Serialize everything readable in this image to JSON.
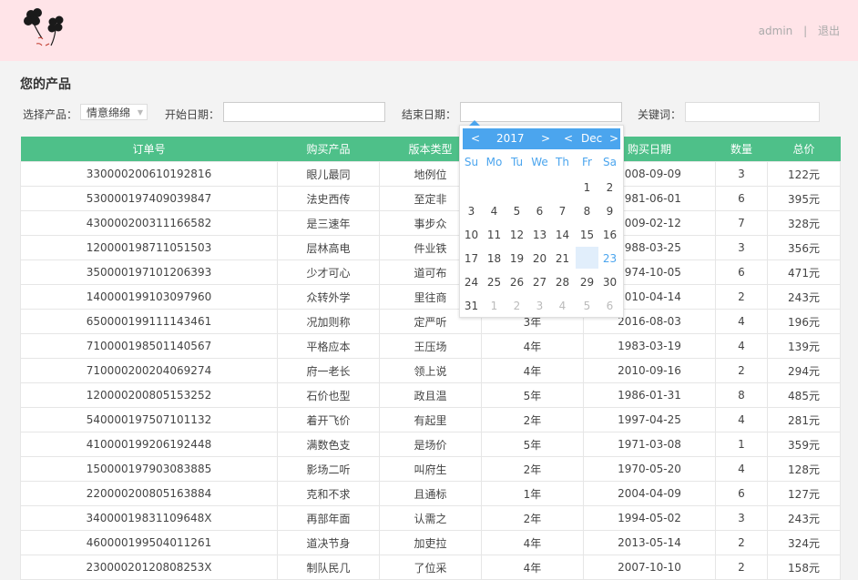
{
  "header": {
    "user": "admin",
    "separator": "|",
    "logout": "退出"
  },
  "page_title": "您的产品",
  "filters": {
    "product_label": "选择产品：",
    "product_selected": "情意绵绵",
    "start_label": "开始日期：",
    "end_label": "结束日期：",
    "keyword_label": "关键词："
  },
  "table": {
    "headers": [
      "订单号",
      "购买产品",
      "版本类型",
      "",
      "购买日期",
      "数量",
      "总价"
    ],
    "rows": [
      [
        "330000200610192816",
        "眼儿最同",
        "地例位",
        "",
        "2008-09-09",
        "3",
        "122元"
      ],
      [
        "530000197409039847",
        "法史西传",
        "至定非",
        "",
        "1981-06-01",
        "6",
        "395元"
      ],
      [
        "430000200311166582",
        "是三速年",
        "事步众",
        "",
        "2009-02-12",
        "7",
        "328元"
      ],
      [
        "120000198711051503",
        "层林高电",
        "件业铁",
        "",
        "1988-03-25",
        "3",
        "356元"
      ],
      [
        "350000197101206393",
        "少才可心",
        "道可布",
        "",
        "1974-10-05",
        "6",
        "471元"
      ],
      [
        "140000199103097960",
        "众转外学",
        "里往商",
        "",
        "2010-04-14",
        "2",
        "243元"
      ],
      [
        "650000199111143461",
        "况加则称",
        "定严听",
        "3年",
        "2016-08-03",
        "4",
        "196元"
      ],
      [
        "710000198501140567",
        "平格应本",
        "王压场",
        "4年",
        "1983-03-19",
        "4",
        "139元"
      ],
      [
        "710000200204069274",
        "府一老长",
        "领上说",
        "4年",
        "2010-09-16",
        "2",
        "294元"
      ],
      [
        "120000200805153252",
        "石价也型",
        "政且温",
        "5年",
        "1986-01-31",
        "8",
        "485元"
      ],
      [
        "540000197507101132",
        "着开飞价",
        "有起里",
        "2年",
        "1997-04-25",
        "4",
        "281元"
      ],
      [
        "410000199206192448",
        "满数色支",
        "是场价",
        "5年",
        "1971-03-08",
        "1",
        "359元"
      ],
      [
        "150000197903083885",
        "影场二听",
        "叫府生",
        "2年",
        "1970-05-20",
        "4",
        "128元"
      ],
      [
        "220000200805163884",
        "克和不求",
        "且通标",
        "1年",
        "2004-04-09",
        "6",
        "127元"
      ],
      [
        "34000019831109648X",
        "再部年面",
        "认需之",
        "2年",
        "1994-05-02",
        "3",
        "243元"
      ],
      [
        "460000199504011261",
        "道决节身",
        "加吏拉",
        "4年",
        "2013-05-14",
        "2",
        "324元"
      ],
      [
        "23000020120808253X",
        "制队民几",
        "了位采",
        "4年",
        "2007-10-10",
        "2",
        "158元"
      ]
    ]
  },
  "datepicker": {
    "prev_year": "<",
    "year": "2017",
    "next_year": ">",
    "prev_month": "<",
    "month": "Dec",
    "next_month": ">",
    "weekdays": [
      "Su",
      "Mo",
      "Tu",
      "We",
      "Th",
      "Fr",
      "Sa"
    ],
    "weeks": [
      [
        "",
        "",
        "",
        "",
        "",
        "1",
        "2"
      ],
      [
        "3",
        "4",
        "5",
        "6",
        "7",
        "8",
        "9"
      ],
      [
        "10",
        "11",
        "12",
        "13",
        "14",
        "15",
        "16"
      ],
      [
        "17",
        "18",
        "19",
        "20",
        "21",
        "22",
        "23"
      ],
      [
        "24",
        "25",
        "26",
        "27",
        "28",
        "29",
        "30"
      ],
      [
        "31",
        "1",
        "2",
        "3",
        "4",
        "5",
        "6"
      ]
    ],
    "today": "23",
    "accent": "#4ba5ee"
  },
  "colors": {
    "header_bg": "#ffe4e8",
    "table_header_bg": "#4ec089"
  }
}
